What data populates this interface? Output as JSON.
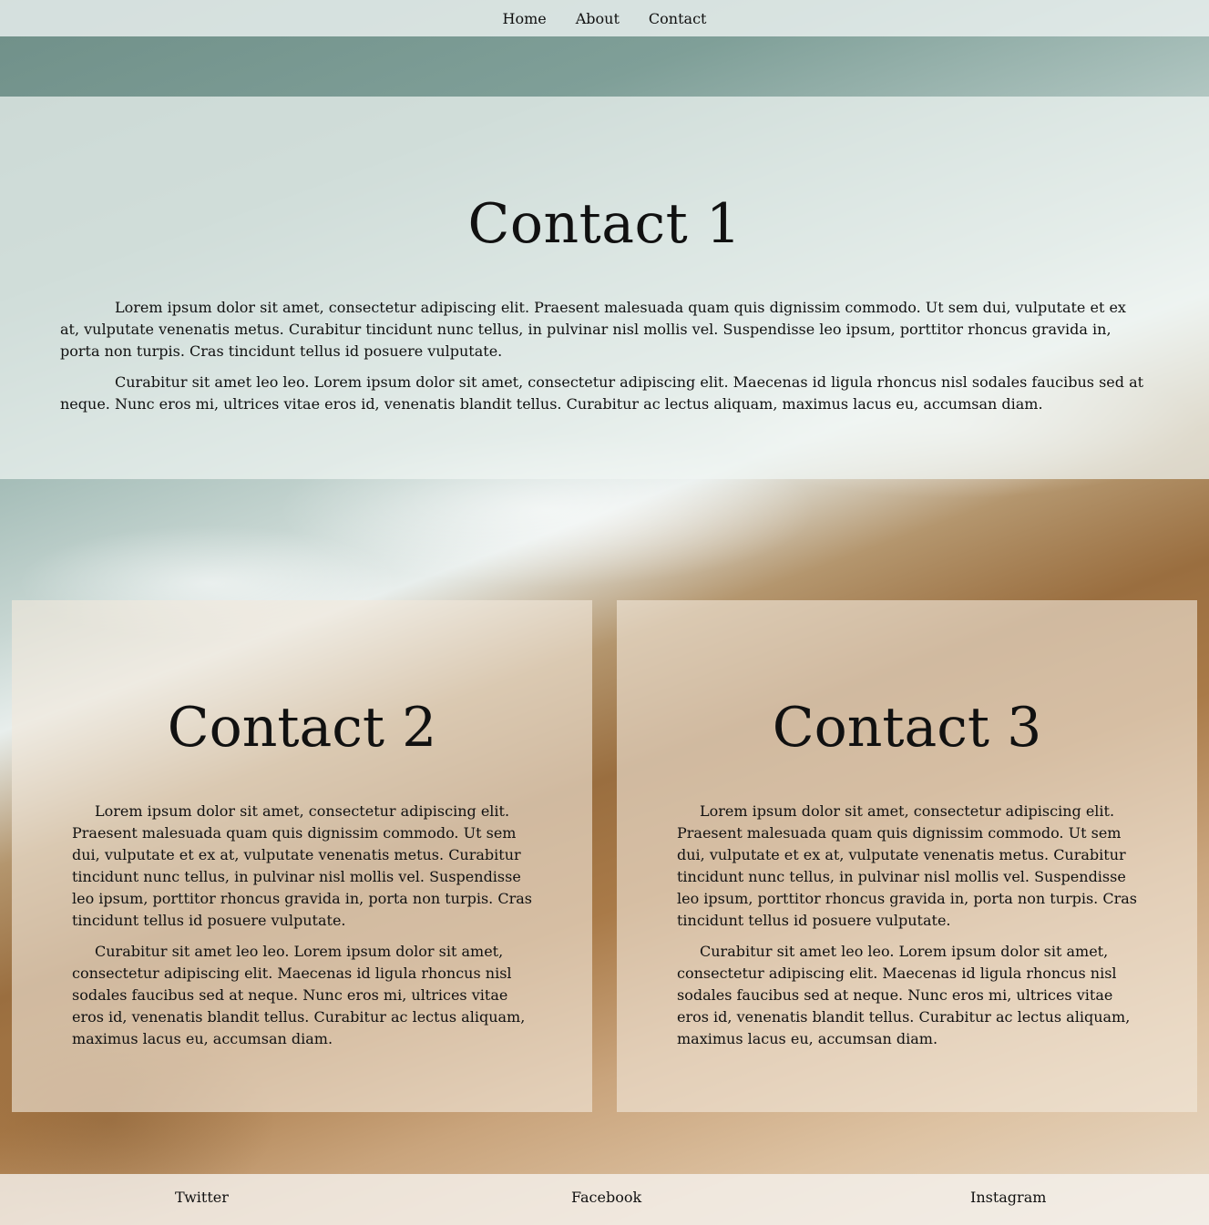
{
  "nav": {
    "items": [
      {
        "label": "Home"
      },
      {
        "label": "About"
      },
      {
        "label": "Contact"
      }
    ]
  },
  "contact1": {
    "title": "Contact 1",
    "paragraphs": [
      "Lorem ipsum dolor sit amet, consectetur adipiscing elit. Praesent malesuada quam quis dignissim commodo. Ut sem dui, vulputate et ex at, vulputate venenatis metus. Curabitur tincidunt nunc tellus, in pulvinar nisl mollis vel. Suspendisse leo ipsum, porttitor rhoncus gravida in, porta non turpis. Cras tincidunt tellus id posuere vulputate.",
      "Curabitur sit amet leo leo. Lorem ipsum dolor sit amet, consectetur adipiscing elit. Maecenas id ligula rhoncus nisl sodales faucibus sed at neque. Nunc eros mi, ultrices vitae eros id, venenatis blandit tellus. Curabitur ac lectus aliquam, maximus lacus eu, accumsan diam."
    ]
  },
  "contact2": {
    "title": "Contact 2",
    "paragraphs": [
      "Lorem ipsum dolor sit amet, consectetur adipiscing elit. Praesent malesuada quam quis dignissim commodo. Ut sem dui, vulputate et ex at, vulputate venenatis metus. Curabitur tincidunt nunc tellus, in pulvinar nisl mollis vel. Suspendisse leo ipsum, porttitor rhoncus gravida in, porta non turpis. Cras tincidunt tellus id posuere vulputate.",
      "Curabitur sit amet leo leo. Lorem ipsum dolor sit amet, consectetur adipiscing elit. Maecenas id ligula rhoncus nisl sodales faucibus sed at neque. Nunc eros mi, ultrices vitae eros id, venenatis blandit tellus. Curabitur ac lectus aliquam, maximus lacus eu, accumsan diam."
    ]
  },
  "contact3": {
    "title": "Contact 3",
    "paragraphs": [
      "Lorem ipsum dolor sit amet, consectetur adipiscing elit. Praesent malesuada quam quis dignissim commodo. Ut sem dui, vulputate et ex at, vulputate venenatis metus. Curabitur tincidunt nunc tellus, in pulvinar nisl mollis vel. Suspendisse leo ipsum, porttitor rhoncus gravida in, porta non turpis. Cras tincidunt tellus id posuere vulputate.",
      "Curabitur sit amet leo leo. Lorem ipsum dolor sit amet, consectetur adipiscing elit. Maecenas id ligula rhoncus nisl sodales faucibus sed at neque. Nunc eros mi, ultrices vitae eros id, venenatis blandit tellus. Curabitur ac lectus aliquam, maximus lacus eu, accumsan diam."
    ]
  },
  "footer": {
    "links": [
      {
        "label": "Twitter"
      },
      {
        "label": "Facebook"
      },
      {
        "label": "Instagram"
      }
    ]
  }
}
